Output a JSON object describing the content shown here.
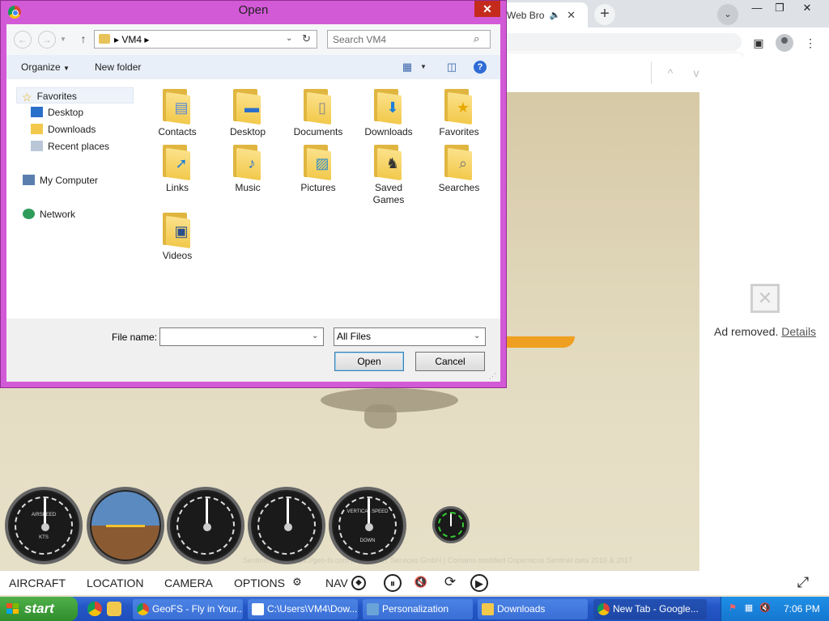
{
  "browser": {
    "tab_title": "Web Bro",
    "find_bar": {
      "prev": "^",
      "next": "v",
      "close": "✕"
    },
    "ad": {
      "text": "Ad removed.",
      "link": "Details"
    }
  },
  "game": {
    "credit": "Sentinel, Inc. | https://geo-fs.com | by SOS IT Services GmbH | Contains modified Copernicus Sentinel data 2016 & 2017",
    "menu": {
      "aircraft": "AIRCRAFT",
      "location": "LOCATION",
      "camera": "CAMERA",
      "options": "OPTIONS",
      "nav": "NAV"
    },
    "instruments": [
      {
        "name": "AIRSPEED",
        "sub": "KTS"
      },
      {
        "name": "ATTITUDE",
        "sub": ""
      },
      {
        "name": "ALTITUDE",
        "sub": ""
      },
      {
        "name": "HEADING",
        "sub": ""
      },
      {
        "name": "VERTICAL SPEED",
        "sub": "DOWN"
      },
      {
        "name": "RPM",
        "sub": ""
      }
    ]
  },
  "dialog": {
    "title": "Open",
    "breadcrumb": "VM4",
    "search_placeholder": "Search VM4",
    "toolbar": {
      "organize": "Organize",
      "new_folder": "New folder"
    },
    "nav": {
      "favorites": "Favorites",
      "desktop": "Desktop",
      "downloads": "Downloads",
      "recent": "Recent places",
      "computer": "My Computer",
      "network": "Network"
    },
    "folders": [
      {
        "label": "Contacts",
        "icon": "contacts-icon"
      },
      {
        "label": "Desktop",
        "icon": "desktop-icon"
      },
      {
        "label": "Documents",
        "icon": "documents-icon"
      },
      {
        "label": "Downloads",
        "icon": "downloads-icon"
      },
      {
        "label": "Favorites",
        "icon": "favorites-icon"
      },
      {
        "label": "Links",
        "icon": "links-icon"
      },
      {
        "label": "Music",
        "icon": "music-icon"
      },
      {
        "label": "Pictures",
        "icon": "pictures-icon"
      },
      {
        "label": "Saved Games",
        "icon": "saved-games-icon"
      },
      {
        "label": "Searches",
        "icon": "searches-icon"
      },
      {
        "label": "Videos",
        "icon": "videos-icon"
      }
    ],
    "file_name_label": "File name:",
    "file_name_value": "",
    "file_type": "All Files",
    "open_button": "Open",
    "cancel_button": "Cancel"
  },
  "taskbar": {
    "start": "start",
    "items": [
      {
        "label": "GeoFS - Fly in Your...",
        "color": "#ffffff"
      },
      {
        "label": "C:\\Users\\VM4\\Dow...",
        "color": "#ffffff"
      },
      {
        "label": "Personalization",
        "color": "#ffffff"
      },
      {
        "label": "Downloads",
        "color": "#ffffff"
      },
      {
        "label": "New Tab - Google...",
        "color": "#ffffff"
      }
    ],
    "clock": "7:06 PM"
  },
  "colors": {
    "dialog_frame": "#d35ad7",
    "taskbar": "#2456c6",
    "start_button": "#3a9b35"
  }
}
